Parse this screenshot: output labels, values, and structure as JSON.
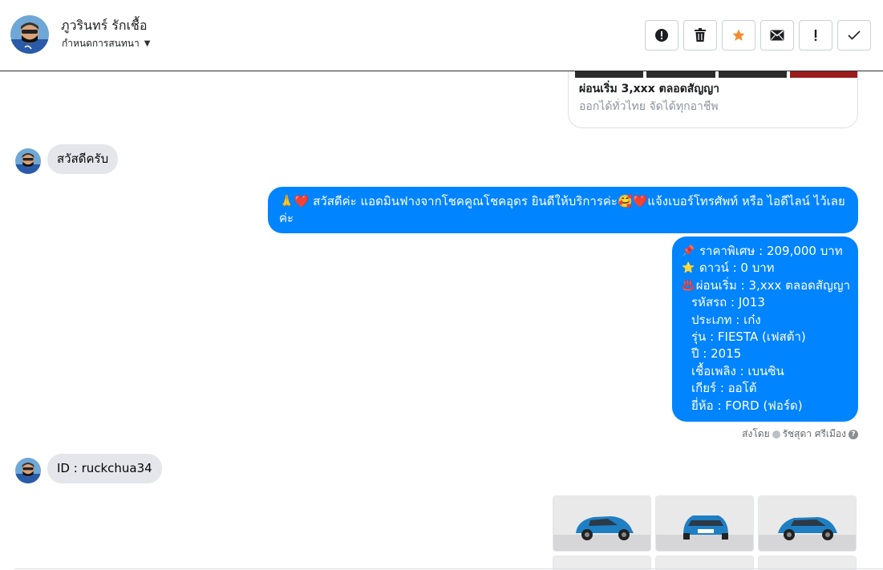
{
  "header": {
    "contact_name": "ภูวรินทร์ รักเชื้อ",
    "assign_label": "กำหนดการสนทนา",
    "actions": [
      {
        "name": "report-spam-button",
        "icon": "alert-circle-icon"
      },
      {
        "name": "delete-button",
        "icon": "trash-icon"
      },
      {
        "name": "star-button",
        "icon": "star-icon"
      },
      {
        "name": "mark-unread-button",
        "icon": "envelope-icon"
      },
      {
        "name": "follow-up-button",
        "icon": "exclamation-icon"
      },
      {
        "name": "mark-done-button",
        "icon": "checkmark-icon"
      }
    ]
  },
  "colors": {
    "accent_blue": "#0084ff",
    "incoming_bubble": "#e4e6eb",
    "star_orange": "#f28b30"
  },
  "card": {
    "title": "ผ่อนเริ่ม 3,xxx ตลอดสัญญา",
    "subtitle": "ออกได้ทั่วไทย จัดได้ทุกอาชีพ"
  },
  "messages": {
    "incoming_1": "สวัสดีครับ",
    "outgoing_1": "🙏❤️ สวัสดีค่ะ แอดมินฟางจากโชคคูณโชคอุดร ยินดีให้บริการค่ะ🥰❤️แจ้งเบอร์โทรศัพท์ หรือ ไอดีไลน์  ไว้เลยค่ะ",
    "details": [
      {
        "icon": "📌",
        "text": "ราคาพิเศษ : 209,000 บาท"
      },
      {
        "icon": "⭐",
        "text": "ดาวน์ : 0 บาท"
      },
      {
        "icon": "♨️",
        "text": "ผ่อนเริ่ม : 3,xxx ตลอดสัญญา"
      },
      {
        "icon": "",
        "text": "รหัสรถ : J013"
      },
      {
        "icon": "",
        "text": "ประเภท : เก๋ง"
      },
      {
        "icon": "",
        "text": "รุ่น : FIESTA (เฟสต้า)"
      },
      {
        "icon": "",
        "text": "ปี : 2015"
      },
      {
        "icon": "",
        "text": "เชื้อเพลิง : เบนซิน"
      },
      {
        "icon": "",
        "text": "เกียร์ : ออโต้"
      },
      {
        "icon": "",
        "text": "ยี่ห้อ : FORD (ฟอร์ด)"
      }
    ],
    "sent_by_prefix": "ส่งโดย",
    "sent_by_name": "รัชสุดา ศรีเมือง",
    "incoming_2": "ID : ruckchua34"
  }
}
